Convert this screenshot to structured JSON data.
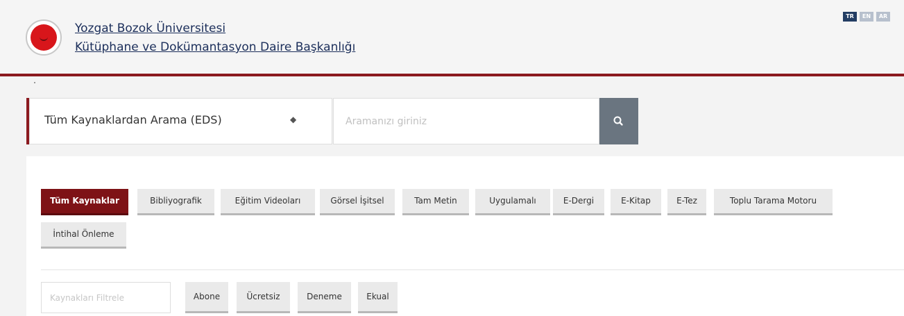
{
  "header": {
    "university": "Yozgat Bozok Üniversitesi",
    "department": "Kütüphane ve Dokümantasyon Daire Başkanlığı",
    "languages": [
      "TR",
      "EN",
      "AR"
    ],
    "accent_color": "#8b1a1f"
  },
  "search": {
    "scope_selected": "Tüm Kaynaklardan Arama (EDS)",
    "placeholder": "Aramanızı giriniz",
    "button_icon": "search-icon"
  },
  "tabs": [
    {
      "label": "Tüm Kaynaklar",
      "active": true
    },
    {
      "label": "Bibliyografik",
      "active": false
    },
    {
      "label": "Eğitim Videoları",
      "active": false
    },
    {
      "label": "Görsel İşitsel",
      "active": false
    },
    {
      "label": "Tam Metin",
      "active": false
    },
    {
      "label": "Uygulamalı",
      "active": false
    },
    {
      "label": "E-Dergi",
      "active": false
    },
    {
      "label": "E-Kitap",
      "active": false
    },
    {
      "label": "E-Tez",
      "active": false
    },
    {
      "label": "Toplu Tarama Motoru",
      "active": false
    },
    {
      "label": "İntihal Önleme",
      "active": false
    }
  ],
  "filter": {
    "placeholder": "Kaynakları Filtrele",
    "tags": [
      "Abone",
      "Ücretsiz",
      "Deneme",
      "Ekual"
    ]
  }
}
